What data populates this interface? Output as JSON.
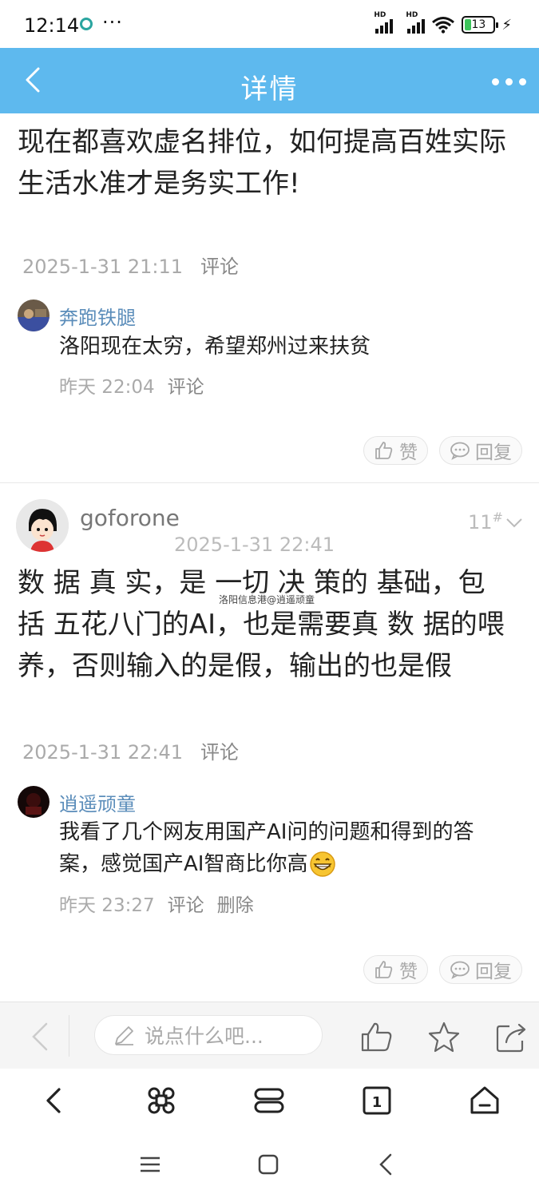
{
  "status_bar": {
    "time": "12:14",
    "dots": "···",
    "hd1": "HD",
    "hd2": "HD",
    "battery": "13"
  },
  "header": {
    "title": "详情"
  },
  "top_comment": {
    "text_line1": "现在都喜欢虚名排位，如何提高百姓实际",
    "text_line2": "生活水准才是务实工作!",
    "date": "2025-1-31 21:11",
    "comment_label": "评论",
    "reply": {
      "user": "奔跑铁腿",
      "text": "洛阳现在太穷，希望郑州过来扶贫",
      "time": "昨天 22:04",
      "comment_label": "评论"
    },
    "like_label": "赞",
    "reply_label": "回复"
  },
  "floor_comment": {
    "user": "goforone",
    "floor": "11",
    "floor_mark": "#",
    "date": "2025-1-31 22:41",
    "text_line1": "数 据 真 实，是 一切 决  策的 基础，包",
    "text_line2": "括 五花八门的AI，也是需要真 数  据的喂",
    "text_line3": "养，否则输入的是假，输出的也是假",
    "watermark": "洛阳信息港@逍遥顽童",
    "footer_date": "2025-1-31 22:41",
    "comment_label": "评论",
    "reply": {
      "user": "逍遥顽童",
      "text_line1": "我看了几个网友用国产AI问的问题和得到的答",
      "text_line2": "案，感觉国产AI智商比你高",
      "time": "昨天 23:27",
      "comment_label": "评论",
      "delete_label": "删除"
    },
    "like_label": "赞",
    "reply_label": "回复"
  },
  "comment_bar": {
    "placeholder": "说点什么吧..."
  }
}
